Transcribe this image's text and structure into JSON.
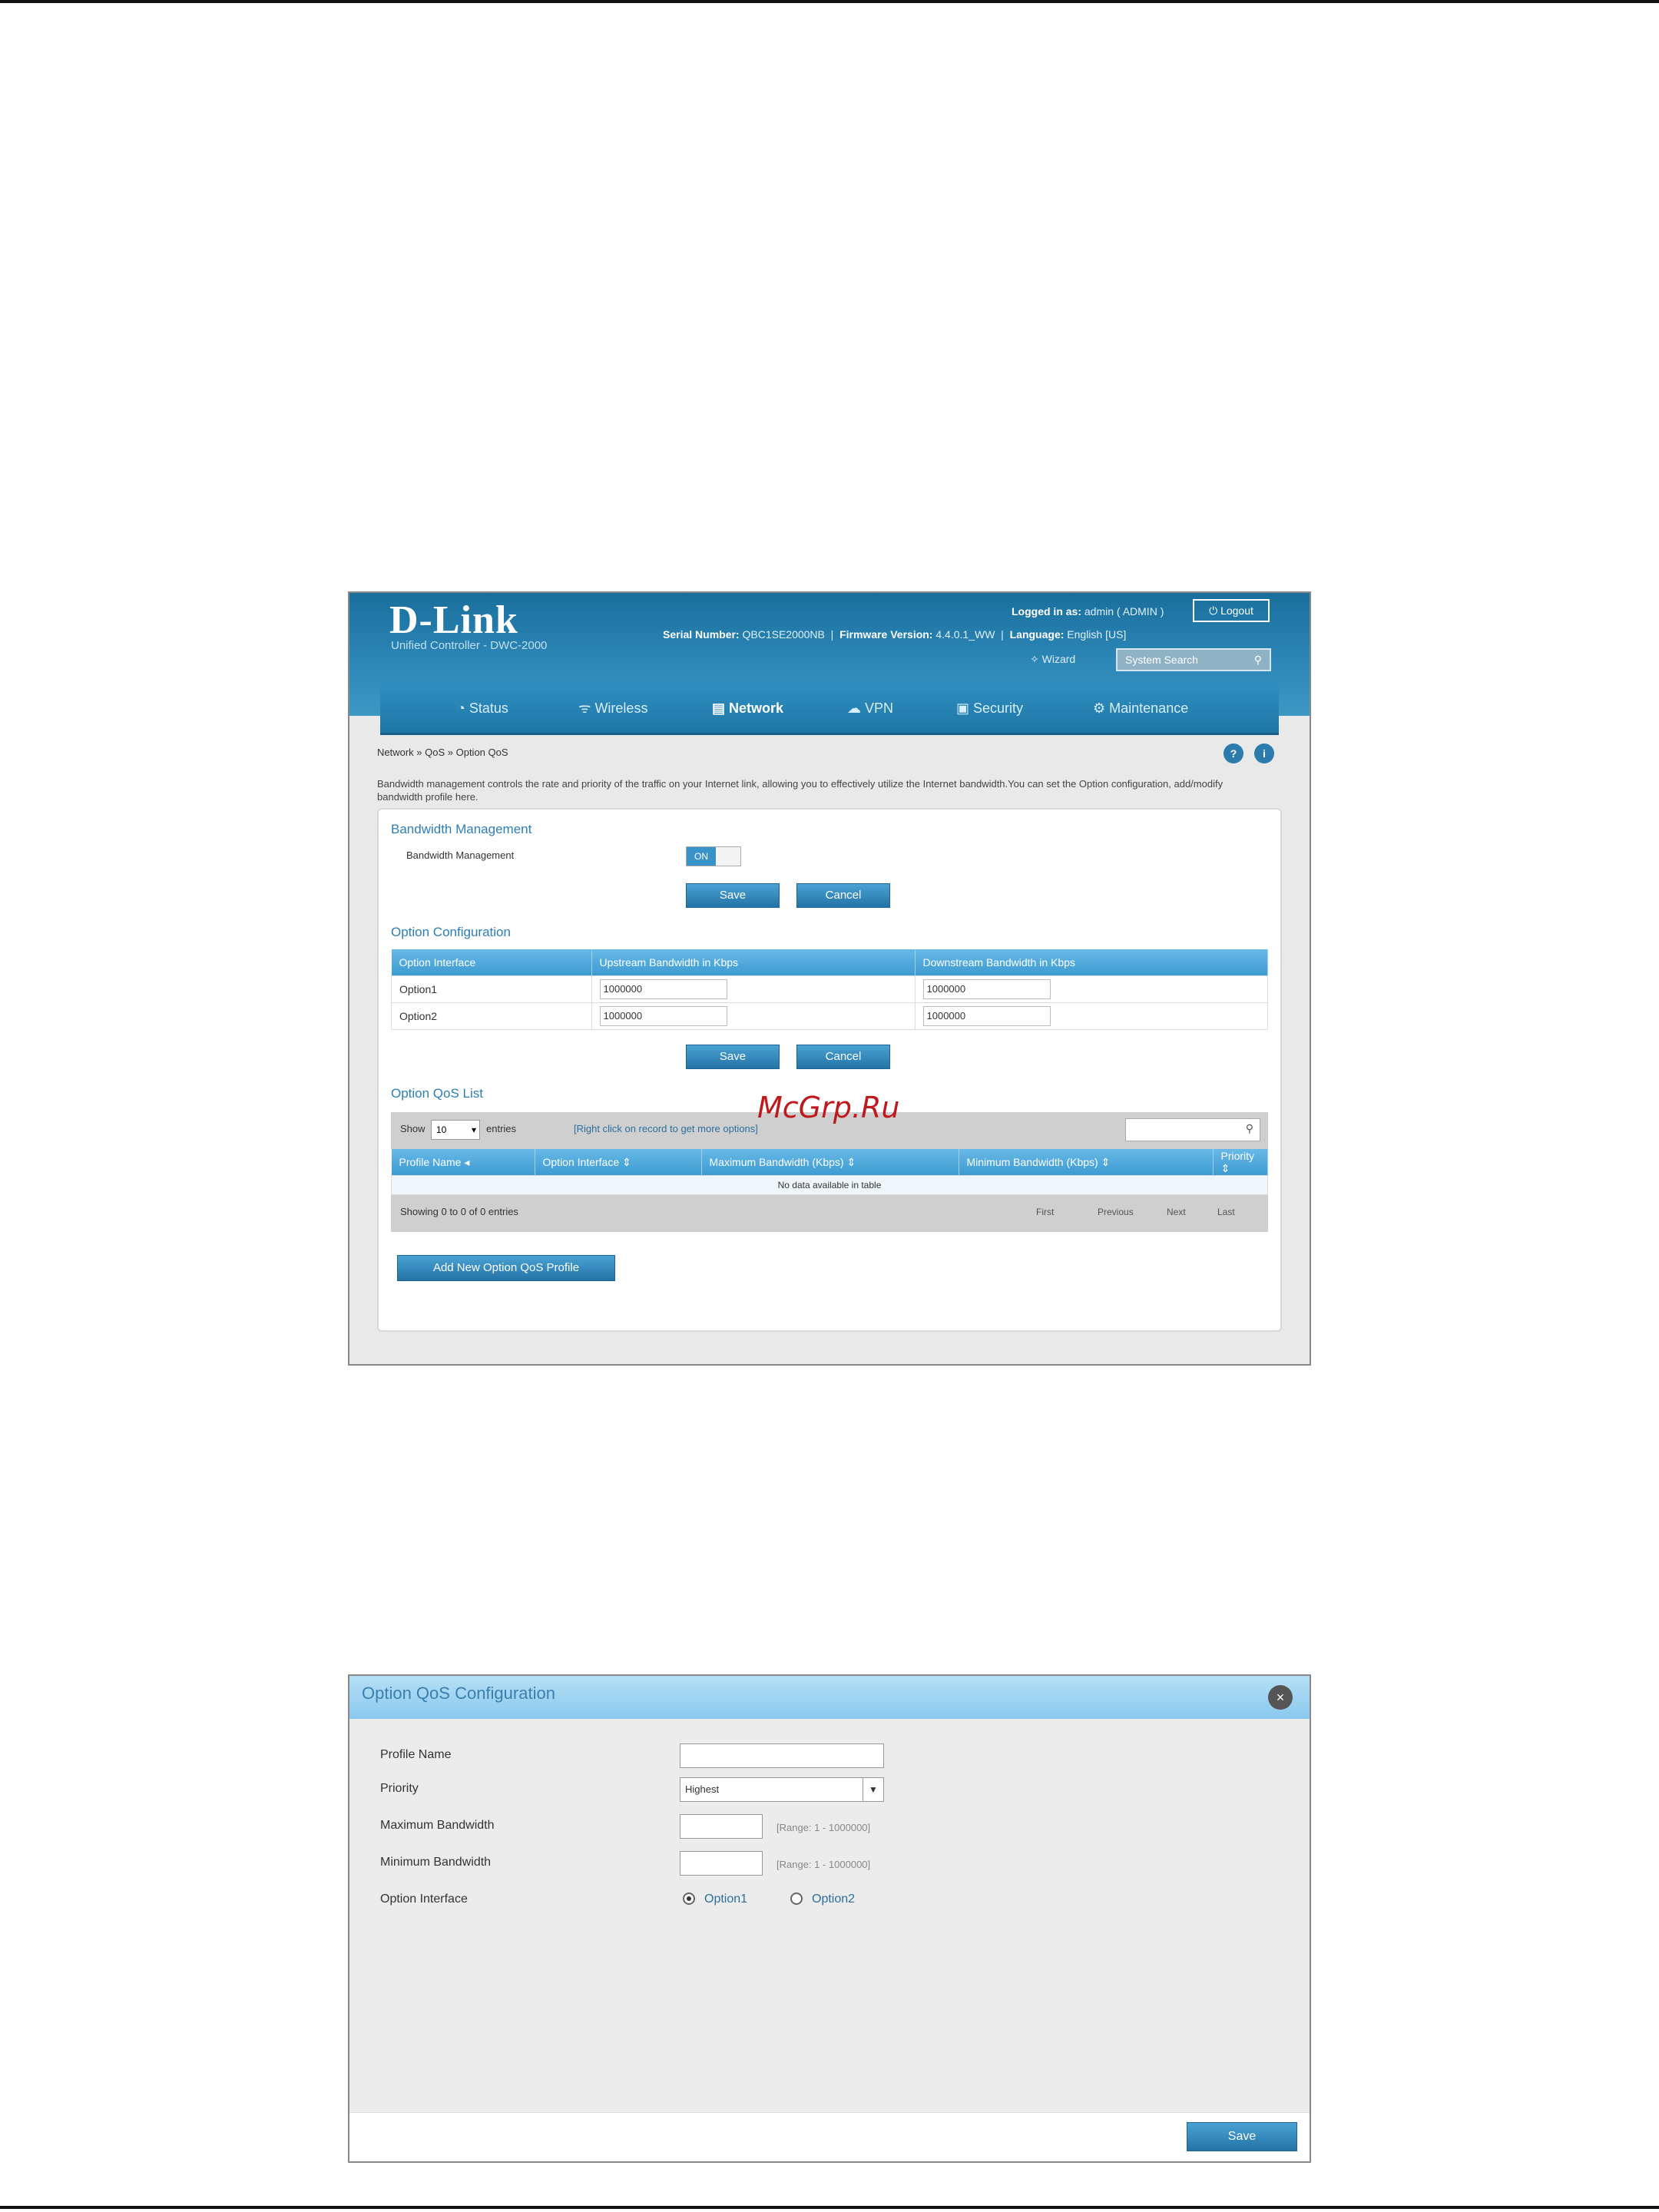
{
  "watermark": "McGrp.Ru",
  "shot1": {
    "brand": "D-Link",
    "product": "Unified Controller - DWC-2000",
    "header": {
      "serial_label": "Serial Number:",
      "serial_value": "QBC1SE2000NB",
      "firmware_label": "Firmware Version:",
      "firmware_value": "4.4.0.1_WW",
      "logged_label": "Logged in as:",
      "logged_value": "admin ( ADMIN )",
      "language_label": "Language:",
      "language_value": "English [US]",
      "wizard": "Wizard",
      "logout": "Logout",
      "search_placeholder": "System Search"
    },
    "nav": [
      "Status",
      "Wireless",
      "Network",
      "VPN",
      "Security",
      "Maintenance"
    ],
    "breadcrumb": "Network  »  QoS  »  Option QoS",
    "description": "Bandwidth management controls the rate and priority of the traffic on your Internet link, allowing you to effectively utilize the Internet bandwidth.You can set the Option configuration, add/modify bandwidth profile here.",
    "bw_section_title": "Bandwidth Management",
    "bw_field_label": "Bandwidth Management",
    "bw_toggle_on": "ON",
    "save": "Save",
    "cancel": "Cancel",
    "option_config_title": "Option Configuration",
    "option_table": {
      "headers": [
        "Option Interface",
        "Upstream Bandwidth in Kbps",
        "Downstream Bandwidth in Kbps"
      ],
      "rows": [
        [
          "Option1",
          "1000000",
          "1000000"
        ],
        [
          "Option2",
          "1000000",
          "1000000"
        ]
      ]
    },
    "qos_list_title": "Option QoS List",
    "show_label": "Show",
    "show_value": "10",
    "entries_label": "entries",
    "right_click_hint": "[Right click on record to get more options]",
    "qos_headers": [
      "Profile Name",
      "Option Interface",
      "Maximum Bandwidth (Kbps)",
      "Minimum Bandwidth (Kbps)",
      "Priority"
    ],
    "no_data": "No data available in table",
    "showing": "Showing 0 to 0 of 0 entries",
    "pager": [
      "First",
      "Previous",
      "Next",
      "Last"
    ],
    "add_button": "Add New Option QoS Profile"
  },
  "shot2": {
    "title": "Option QoS Configuration",
    "labels": {
      "profile_name": "Profile Name",
      "priority": "Priority",
      "max_bw": "Maximum Bandwidth",
      "min_bw": "Minimum Bandwidth",
      "option_interface": "Option Interface"
    },
    "priority_value": "Highest",
    "max_range": "[Range: 1 - 1000000]",
    "min_range": "[Range: 1 - 1000000]",
    "radio1": "Option1",
    "radio2": "Option2",
    "save": "Save"
  }
}
